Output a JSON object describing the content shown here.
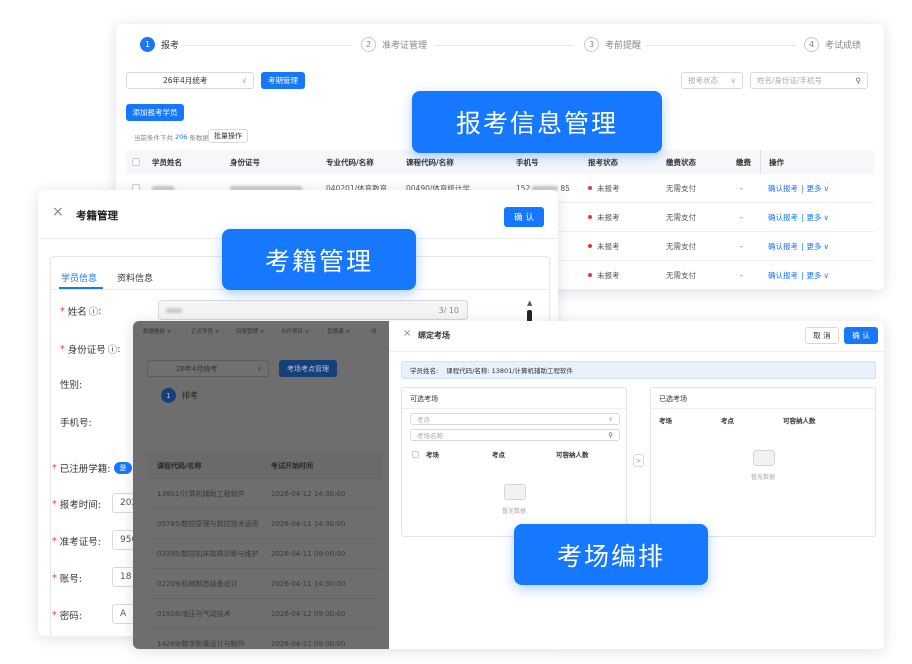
{
  "registration": {
    "steps": [
      {
        "num": "1",
        "label": "报考"
      },
      {
        "num": "2",
        "label": "准考证管理"
      },
      {
        "num": "3",
        "label": "考前提醒"
      },
      {
        "num": "4",
        "label": "考试成绩"
      }
    ],
    "period_select": "26年4月统考",
    "period_button": "考期管理",
    "status_filter_placeholder": "报考状态",
    "search_placeholder": "姓名/身份证/手机号",
    "add_button": "添加报考学员",
    "count_prefix": "当前条件下共",
    "count_value": "206",
    "count_suffix": "条数据",
    "batch_button": "批量操作",
    "columns": [
      "学员姓名",
      "身份证号",
      "专业代码/名称",
      "课程代码/名称",
      "手机号",
      "报考状态",
      "缴费状态",
      "缴费",
      "操作"
    ],
    "row": {
      "major": "040201/体育教育",
      "course": "00490/体育统计学",
      "phone_start": "152",
      "phone_end": "85",
      "status": "未报考",
      "fee": "无需支付",
      "fee_extra": "-",
      "confirm": "确认报考",
      "sep": "|",
      "more": "更多",
      "more_caret": "∨"
    }
  },
  "enrollment": {
    "title": "考籍管理",
    "close_icon": "×",
    "confirm_button": "确 认",
    "tabs": [
      "学员信息",
      "资料信息"
    ],
    "fields": {
      "name": "姓名",
      "name_counter": "3/ 10",
      "id_number": "身份证号",
      "info_icon": "ⓘ",
      "gender": "性别:",
      "phone": "手机号:",
      "registered": "已注册学籍:",
      "registered_toggle": "是",
      "exam_time": "报考时间:",
      "exam_time_value": "202",
      "ticket": "准考证号:",
      "ticket_value": "950",
      "account": "账号:",
      "account_value": "18",
      "password": "密码:",
      "password_value": "A"
    }
  },
  "venue": {
    "tabs": [
      "数据看板",
      "正式学员",
      "旧版管理",
      "合作项目",
      "直播课",
      "线"
    ],
    "tab_close": "×",
    "period_select": "26年4月统考",
    "venue_button": "考场考点管理",
    "step_num": "1",
    "step_label": "排考",
    "columns": [
      "课程代码/名称",
      "考试开始时间"
    ],
    "rows": [
      {
        "course": "13801/计算机辅助工程软件",
        "time": "2026-04-12 14:30:00"
      },
      {
        "course": "05785/数控原理与数控技术运用",
        "time": "2026-04-11 14:30:00"
      },
      {
        "course": "03395/数控机床故障诊断与维护",
        "time": "2026-04-11 09:00:00"
      },
      {
        "course": "02209/机械制造装备设计",
        "time": "2026-04-11 14:30:00"
      },
      {
        "course": "01928/液压与气动技术",
        "time": "2026-04-12 09:00:00"
      },
      {
        "course": "14269/数字影像设计与制作",
        "time": "2026-04-12 09:00:00"
      }
    ],
    "dialog": {
      "close_icon": "×",
      "title": "绑定考场",
      "cancel": "取 消",
      "confirm": "确 认",
      "info_prefix": "学员姓名:",
      "info_course": "课程代码/名称: 13801/计算机辅助工程软件",
      "available_title": "可选考场",
      "selected_title": "已选考场",
      "point_placeholder": "考点",
      "venue_placeholder": "考场名称",
      "columns": [
        "考场",
        "考点",
        "可容纳人数"
      ],
      "empty": "暂无数据",
      "transfer": ">"
    }
  },
  "labels": {
    "registration": "报考信息管理",
    "enrollment": "考籍管理",
    "venue": "考场编排"
  },
  "colors": {
    "primary": "#1677ff",
    "danger": "#e53935"
  }
}
